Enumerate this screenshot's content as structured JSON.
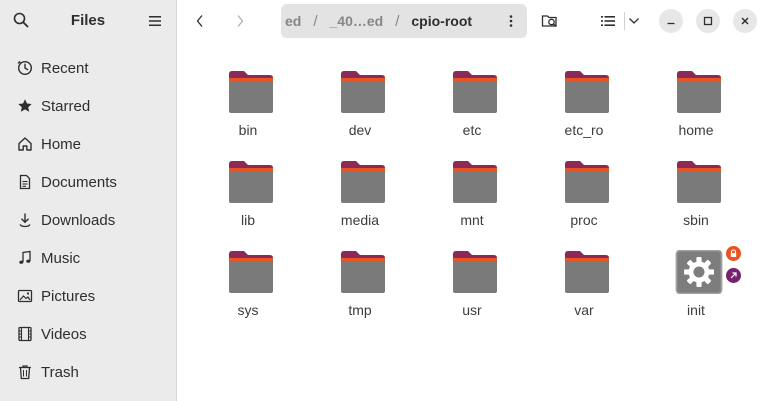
{
  "sidebar": {
    "title": "Files",
    "items": [
      {
        "label": "Recent",
        "icon": "clock-icon"
      },
      {
        "label": "Starred",
        "icon": "star-icon"
      },
      {
        "label": "Home",
        "icon": "home-icon"
      },
      {
        "label": "Documents",
        "icon": "document-icon"
      },
      {
        "label": "Downloads",
        "icon": "download-icon"
      },
      {
        "label": "Music",
        "icon": "music-icon"
      },
      {
        "label": "Pictures",
        "icon": "picture-icon"
      },
      {
        "label": "Videos",
        "icon": "video-icon"
      },
      {
        "label": "Trash",
        "icon": "trash-icon"
      }
    ]
  },
  "pathbar": {
    "segments": [
      "ed",
      "_40…ed",
      "cpio-root"
    ]
  },
  "files": [
    {
      "name": "bin",
      "type": "folder"
    },
    {
      "name": "dev",
      "type": "folder"
    },
    {
      "name": "etc",
      "type": "folder"
    },
    {
      "name": "etc_ro",
      "type": "folder"
    },
    {
      "name": "home",
      "type": "folder"
    },
    {
      "name": "lib",
      "type": "folder"
    },
    {
      "name": "media",
      "type": "folder"
    },
    {
      "name": "mnt",
      "type": "folder"
    },
    {
      "name": "proc",
      "type": "folder"
    },
    {
      "name": "sbin",
      "type": "folder"
    },
    {
      "name": "sys",
      "type": "folder"
    },
    {
      "name": "tmp",
      "type": "folder"
    },
    {
      "name": "usr",
      "type": "folder"
    },
    {
      "name": "var",
      "type": "folder"
    },
    {
      "name": "init",
      "type": "executable"
    }
  ],
  "colors": {
    "folder_body": "#7a7a7a",
    "folder_tab": "#8b2a58",
    "folder_accent": "#e95420",
    "lock_emblem": "#e95420",
    "link_emblem": "#77216f"
  }
}
